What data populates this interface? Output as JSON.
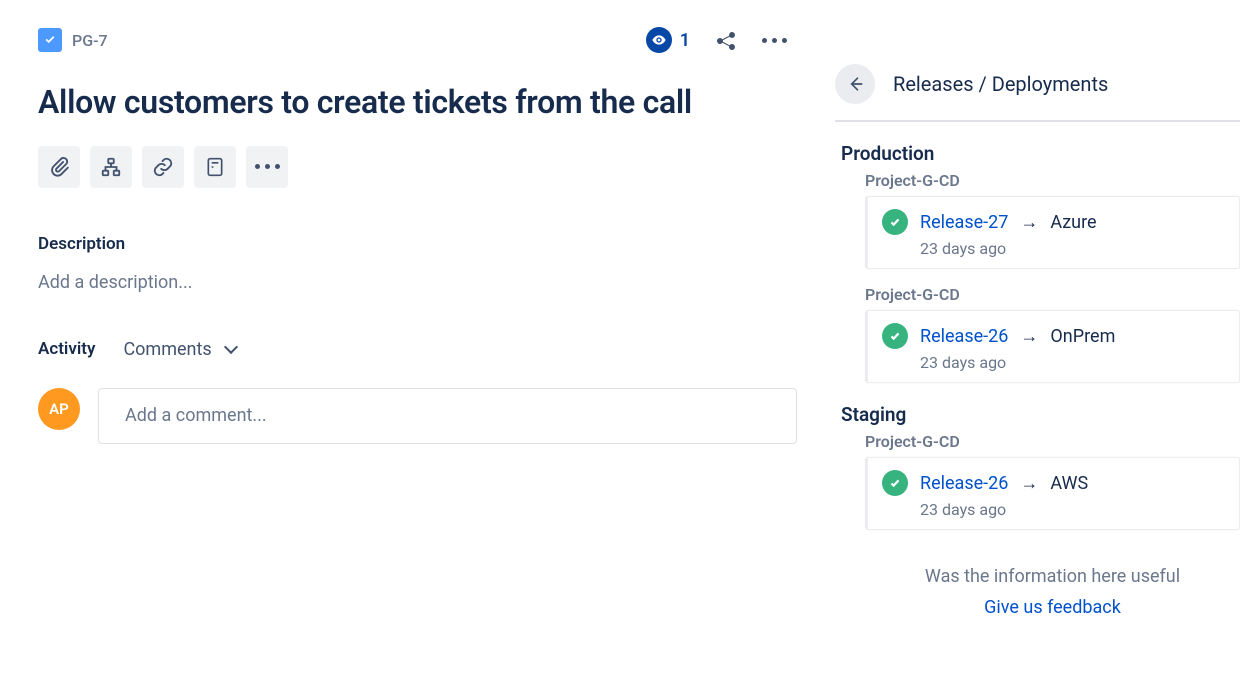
{
  "breadcrumb": {
    "issue_key": "PG-7"
  },
  "header_actions": {
    "watch_count": "1"
  },
  "summary": "Allow customers to create tickets from the call",
  "description": {
    "label": "Description",
    "placeholder": "Add a description..."
  },
  "activity": {
    "label": "Activity",
    "filter": "Comments",
    "avatar_initials": "AP",
    "comment_placeholder": "Add a comment..."
  },
  "releases": {
    "title": "Releases / Deployments",
    "feedback_question": "Was the information here useful",
    "feedback_link": "Give us feedback",
    "environments": [
      {
        "name": "Production",
        "groups": [
          {
            "project": "Project-G-CD",
            "releases": [
              {
                "name": "Release-27",
                "target": "Azure",
                "ago": "23 days ago"
              }
            ]
          },
          {
            "project": "Project-G-CD",
            "releases": [
              {
                "name": "Release-26",
                "target": "OnPrem",
                "ago": "23 days ago"
              }
            ]
          }
        ]
      },
      {
        "name": "Staging",
        "groups": [
          {
            "project": "Project-G-CD",
            "releases": [
              {
                "name": "Release-26",
                "target": "AWS",
                "ago": "23 days ago"
              }
            ]
          }
        ]
      }
    ]
  }
}
